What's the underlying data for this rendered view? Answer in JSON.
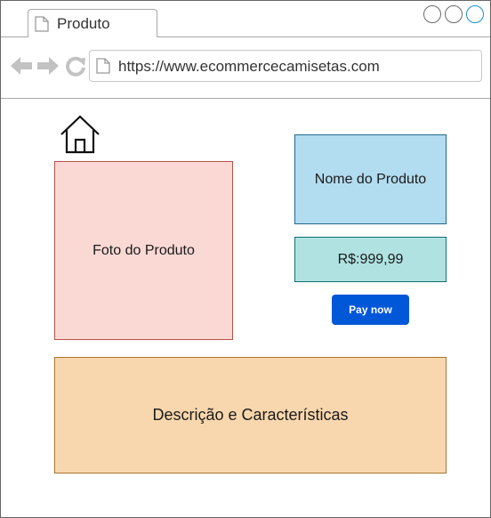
{
  "browser": {
    "tab": {
      "label": "Produto"
    },
    "url": "https://www.ecommercecamisetas.com",
    "icons": {
      "tab_page": "page-icon",
      "back": "arrow-left-icon",
      "forward": "arrow-right-icon",
      "refresh": "refresh-icon",
      "url_page": "page-icon"
    }
  },
  "page": {
    "home_icon": "home-icon",
    "photo_label": "Foto do Produto",
    "product_name": "Nome do Produto",
    "price": "R$:999,99",
    "pay_button_label": "Pay now",
    "description_label": "Descrição e Características"
  },
  "colors": {
    "photo_bg": "#fad9d4",
    "name_bg": "#b2dcf0",
    "price_bg": "#b0e2e2",
    "description_bg": "#f9d7ae",
    "pay_button": "#0057d8"
  }
}
